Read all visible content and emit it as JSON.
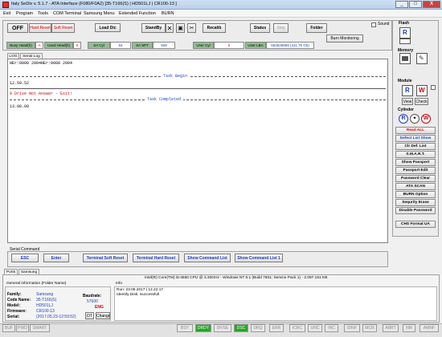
{
  "window": {
    "title": "Italy SeDiv v. 5.1.7 - ATA Interface (F080/F0A2) [35-T166(S) | HD501LJ | CR100-13 ]",
    "minimize": "_",
    "maximize": "□",
    "close": "X"
  },
  "menu": [
    "Exit",
    "Program",
    "Tools",
    "COM Terminal",
    "Samsung Menu",
    "Extended Function",
    "BURN"
  ],
  "toolbar": {
    "off": "OFF",
    "hard_reset": "Hard Reset",
    "soft_reset": "Soft Reset",
    "load_dic": "Load Dic",
    "standby": "StandBy",
    "recalib": "Recalib",
    "status": "Status",
    "stop": "Stop",
    "folder": "Folder",
    "sound": "Sound",
    "burn_monitoring": "Burn Monitoring"
  },
  "registers": {
    "busy_head_label": "Busy Head(h)",
    "busy_head_val": "A",
    "used_head_label": "Used Head(h)",
    "used_head_val": "0",
    "sa_cyl_label": "SA Cyl",
    "sa_cyl_val": "64",
    "sa_spt_label": "SA SPT",
    "sa_spt_val": "929",
    "user_cyl_label": "User Cyl",
    "user_cyl_val": "0",
    "user_lba_label": "User LBA",
    "user_lba_val": "663526959 (411.76 Gb)"
  },
  "log_tabs": [
    "LOG",
    "Serial Log"
  ],
  "console": {
    "line1": "HEr:0000 2004HEr:0000 2004",
    "task_begin": "Task Begin",
    "time1": "12.59.52",
    "error": "0 Drive Not Answer - Exit!",
    "task_completed": "Task Completed",
    "time2": "13.00.00"
  },
  "right_panel": {
    "flash_label": "Flash",
    "memory_label": "Memory",
    "module_label": "Module",
    "view": "View",
    "check": "Check",
    "cylinder_label": "Cylinder",
    "buttons": [
      "Read ALL",
      "Defect List Show",
      "Clr Def. List",
      "S.M.A.R.T.",
      "Show Passport",
      "Passport Edit",
      "Password Clear",
      "ATA SCAN",
      "BURN Option",
      "Sequrity Erase",
      "Disable Password",
      "CHS Format UA"
    ]
  },
  "serial_command": {
    "label": "Serial Command",
    "buttons": [
      "ESC",
      "Enter",
      "Terminal Soft Reset",
      "Terminal Hard Reset",
      "Show Command List",
      "Show Command List 1"
    ]
  },
  "ports_tabs": [
    "Ports",
    "Samsung"
  ],
  "cpu_info": "Intel(R) Core(TM) i5-3550 CPU @ 3.30GHz - Windows NT 6.1 (Build 7601: Service Pack 1) - 2.097.151 KB",
  "general_info": {
    "label": "General information (Folder Name)",
    "family_label": "Family:",
    "family": "Samsung",
    "code_name_label": "Code Name:",
    "code_name": "35-T166(S)",
    "model_label": "Model:",
    "model": "HD501LJ",
    "firmware_label": "Firmware:",
    "firmware": "CR100-13",
    "serial_label": "Serial:",
    "serial": "(2017.05.23-12:59:52)",
    "baudrate_label": "Baudrate:",
    "baudrate": "57600",
    "lang": "ENG",
    "dt": "DT",
    "change": "Change"
  },
  "info": {
    "label": "Info",
    "line1": "Run: 23.05.2017 | 12.22.17",
    "line2": "Identify Disk: Successfull"
  },
  "status_bar": {
    "left": [
      "BUF",
      "PWD",
      "SMART"
    ],
    "flags": [
      "BSY",
      "DRDY",
      "DF/SE",
      "DSC",
      "DRQ",
      "ERR",
      "ICRC",
      "UNC",
      "INC",
      "IDNF",
      "MCR",
      "ABRT",
      "NM",
      "AMNF"
    ],
    "green_flags": [
      "DRDY",
      "DSC"
    ]
  },
  "colors": {
    "error_red": "#cc0000",
    "link_blue": "#1a3fb5",
    "status_green": "#26a626"
  }
}
